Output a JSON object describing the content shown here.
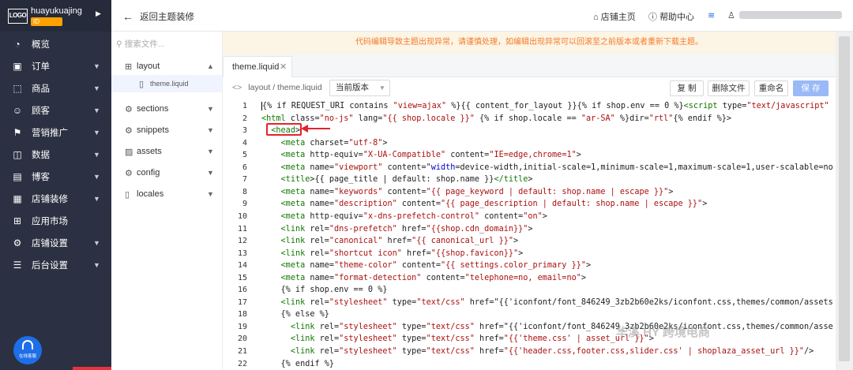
{
  "brand": {
    "logo": "LOGO",
    "store_name": "huayukuajing",
    "store_id": "ID",
    "expand_icon": "caret-right-icon"
  },
  "nav": [
    {
      "label": "概览",
      "icon": "dashboard-icon",
      "chevron": false
    },
    {
      "label": "订单",
      "icon": "order-icon",
      "chevron": true
    },
    {
      "label": "商品",
      "icon": "product-icon",
      "chevron": true
    },
    {
      "label": "顾客",
      "icon": "customer-icon",
      "chevron": true
    },
    {
      "label": "营销推广",
      "icon": "marketing-icon",
      "chevron": true
    },
    {
      "label": "数据",
      "icon": "data-icon",
      "chevron": true
    },
    {
      "label": "博客",
      "icon": "blog-icon",
      "chevron": true
    },
    {
      "label": "店铺装修",
      "icon": "decorate-icon",
      "chevron": true
    },
    {
      "label": "应用市场",
      "icon": "apps-icon",
      "chevron": false
    },
    {
      "label": "店铺设置",
      "icon": "settings-icon",
      "chevron": true
    },
    {
      "label": "后台设置",
      "icon": "admin-icon",
      "chevron": true
    }
  ],
  "help_button": {
    "label": "在线客服"
  },
  "topbar": {
    "back_label": "返回主题装修",
    "store_home": "店铺主页",
    "help_center": "帮助中心"
  },
  "search": {
    "placeholder": "搜索文件..."
  },
  "tree": [
    {
      "label": "layout",
      "icon": "layout-icon",
      "chevron": "▲",
      "sub": [
        {
          "label": "theme.liquid"
        }
      ]
    },
    {
      "label": "sections",
      "icon": "sections-icon",
      "chevron": "▼"
    },
    {
      "label": "snippets",
      "icon": "snippets-icon",
      "chevron": "▼"
    },
    {
      "label": "assets",
      "icon": "assets-icon",
      "chevron": "▼"
    },
    {
      "label": "config",
      "icon": "config-icon",
      "chevron": "▼"
    },
    {
      "label": "locales",
      "icon": "locales-icon",
      "chevron": "▼"
    }
  ],
  "banner": "代码编辑导致主题出现异常，请谨慎处理，如编辑出现异常可以回滚至之前版本或者重新下载主题。",
  "tab": {
    "label": "theme.liquid"
  },
  "toolbar": {
    "path": "layout / theme.liquid",
    "version": "当前版本",
    "copy": "复 制",
    "delete": "删除文件",
    "rename": "重命名",
    "save": "保 存"
  },
  "watermark": "华溪 HY 跨境电商",
  "colors": {
    "sidebar": "#2b3142",
    "accent": "#1d6ee8",
    "highlight": "#e3242b",
    "banner_text": "#f47c2c",
    "banner_bg": "#fcf4e4"
  },
  "code": [
    {
      "n": "1",
      "c": "{% if REQUEST_URI contains \"view=ajax\" %}{{ content_for_layout }}{% if shop.env == 0 %}<script type=\"text/javascript\""
    },
    {
      "n": "2",
      "c": "<html class=\"no-js\" lang=\"{{ shop.locale }}\" {% if shop.locale == \"ar-SA\" %}dir=\"rtl\"{% endif %}>"
    },
    {
      "n": "3",
      "c": "  <head>"
    },
    {
      "n": "4",
      "c": "    <meta charset=\"utf-8\">"
    },
    {
      "n": "5",
      "c": "    <meta http-equiv=\"X-UA-Compatible\" content=\"IE=edge,chrome=1\">"
    },
    {
      "n": "6",
      "c": "    <meta name=\"viewport\" content=\"width=device-width,initial-scale=1,minimum-scale=1,maximum-scale=1,user-scalable=no"
    },
    {
      "n": "7",
      "c": "    <title>{{ page_title | default: shop.name }}</title>"
    },
    {
      "n": "8",
      "c": "    <meta name=\"keywords\" content=\"{{ page_keyword | default: shop.name | escape }}\">"
    },
    {
      "n": "9",
      "c": "    <meta name=\"description\" content=\"{{ page_description | default: shop.name | escape }}\">"
    },
    {
      "n": "10",
      "c": "    <meta http-equiv=\"x-dns-prefetch-control\" content=\"on\">"
    },
    {
      "n": "11",
      "c": "    <link rel=\"dns-prefetch\" href=\"{{shop.cdn_domain}}\">"
    },
    {
      "n": "12",
      "c": "    <link rel=\"canonical\" href=\"{{ canonical_url }}\">"
    },
    {
      "n": "13",
      "c": "    <link rel=\"shortcut icon\" href=\"{{shop.favicon}}\">"
    },
    {
      "n": "14",
      "c": "    <meta name=\"theme-color\" content=\"{{ settings.color_primary }}\">"
    },
    {
      "n": "15",
      "c": "    <meta name=\"format-detection\" content=\"telephone=no, email=no\">"
    },
    {
      "n": "16",
      "c": "    {% if shop.env == 0 %}"
    },
    {
      "n": "17",
      "c": "    <link rel=\"stylesheet\" type=\"text/css\" href=\"{{'iconfont/font_846249_3zb2b60e2ks/iconfont.css,themes/common/assets"
    },
    {
      "n": "18",
      "c": "    {% else %}"
    },
    {
      "n": "19",
      "c": "      <link rel=\"stylesheet\" type=\"text/css\" href=\"{{'iconfont/font_846249_3zb2b60e2ks/iconfont.css,themes/common/asse"
    },
    {
      "n": "20",
      "c": "      <link rel=\"stylesheet\" type=\"text/css\" href=\"{{'theme.css' | asset_url }}\">"
    },
    {
      "n": "21",
      "c": "      <link rel=\"stylesheet\" type=\"text/css\" href=\"{{'header.css,footer.css,slider.css' | shoplaza_asset_url }}\"/>"
    },
    {
      "n": "22",
      "c": "    {% endif %}"
    }
  ]
}
